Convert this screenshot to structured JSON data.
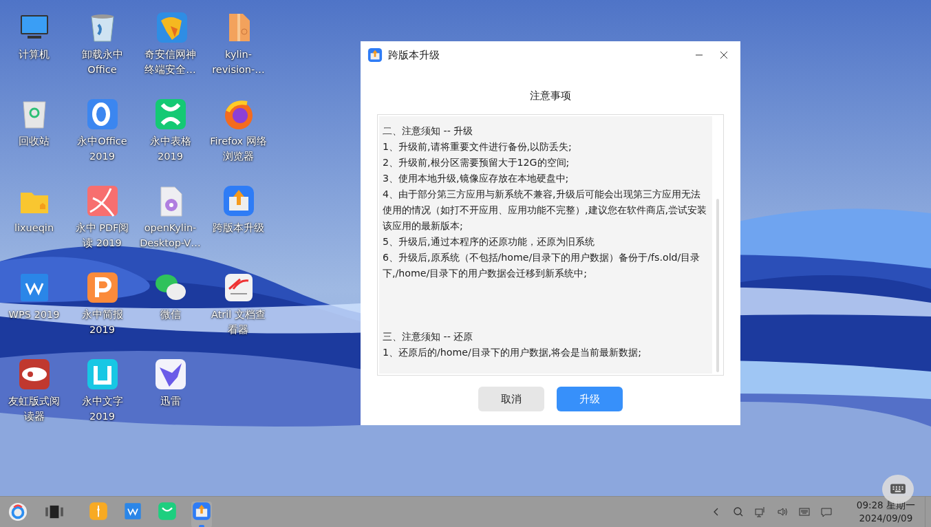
{
  "desktop": {
    "icons": [
      {
        "label": [
          "计算机"
        ]
      },
      {
        "label": [
          "卸载永中",
          "Office"
        ]
      },
      {
        "label": [
          "奇安信网神",
          "终端安全…"
        ]
      },
      {
        "label": [
          "kylin-",
          "revision-…"
        ]
      },
      {
        "label": [
          "回收站"
        ]
      },
      {
        "label": [
          "永中Office",
          "2019"
        ]
      },
      {
        "label": [
          "永中表格",
          "2019"
        ]
      },
      {
        "label": [
          "Firefox 网络",
          "浏览器"
        ]
      },
      {
        "label": [
          "lixueqin"
        ]
      },
      {
        "label": [
          "永中 PDF阅",
          "读 2019"
        ]
      },
      {
        "label": [
          "openKylin-",
          "Desktop-V…"
        ]
      },
      {
        "label": [
          "跨版本升级"
        ]
      },
      {
        "label": [
          "WPS 2019"
        ]
      },
      {
        "label": [
          "永中简报",
          "2019"
        ]
      },
      {
        "label": [
          "微信"
        ]
      },
      {
        "label": [
          "Atril 文档查",
          "看器"
        ]
      },
      {
        "label": [
          "友虹版式阅",
          "读器"
        ]
      },
      {
        "label": [
          "永中文字",
          "2019"
        ]
      },
      {
        "label": [
          "迅雷"
        ]
      }
    ]
  },
  "dialog": {
    "title": "跨版本升级",
    "heading": "注意事项",
    "sections": [
      {
        "heading": "二、注意须知 -- 升级",
        "lines": [
          "1、升级前,请将重要文件进行备份,以防丢失;",
          "2、升级前,根分区需要预留大于12G的空间;",
          "3、使用本地升级,镜像应存放在本地硬盘中;",
          "4、由于部分第三方应用与新系统不兼容,升级后可能会出现第三方应用无法使用的情况（如打不开应用、应用功能不完整）,建议您在软件商店,尝试安装该应用的最新版本;",
          "5、升级后,通过本程序的还原功能，还原为旧系统",
          "6、升级后,原系统（不包括/home/目录下的用户数据）备份于/fs.old/目录下,/home/目录下的用户数据会迁移到新系统中;"
        ]
      },
      {
        "heading": "三、注意须知 -- 还原",
        "lines": [
          "1、还原后的/home/目录下的用户数据,将会是当前最新数据;"
        ]
      }
    ],
    "buttons": [
      {
        "label": "取消",
        "kind": "secondary"
      },
      {
        "label": "升级",
        "kind": "primary"
      }
    ]
  },
  "taskbar": {
    "apps": [
      {
        "active": false
      },
      {
        "active": false
      },
      {
        "active": false
      },
      {
        "active": true
      }
    ],
    "clock": {
      "time": "09:28 星期一",
      "date": "2024/09/09"
    }
  }
}
